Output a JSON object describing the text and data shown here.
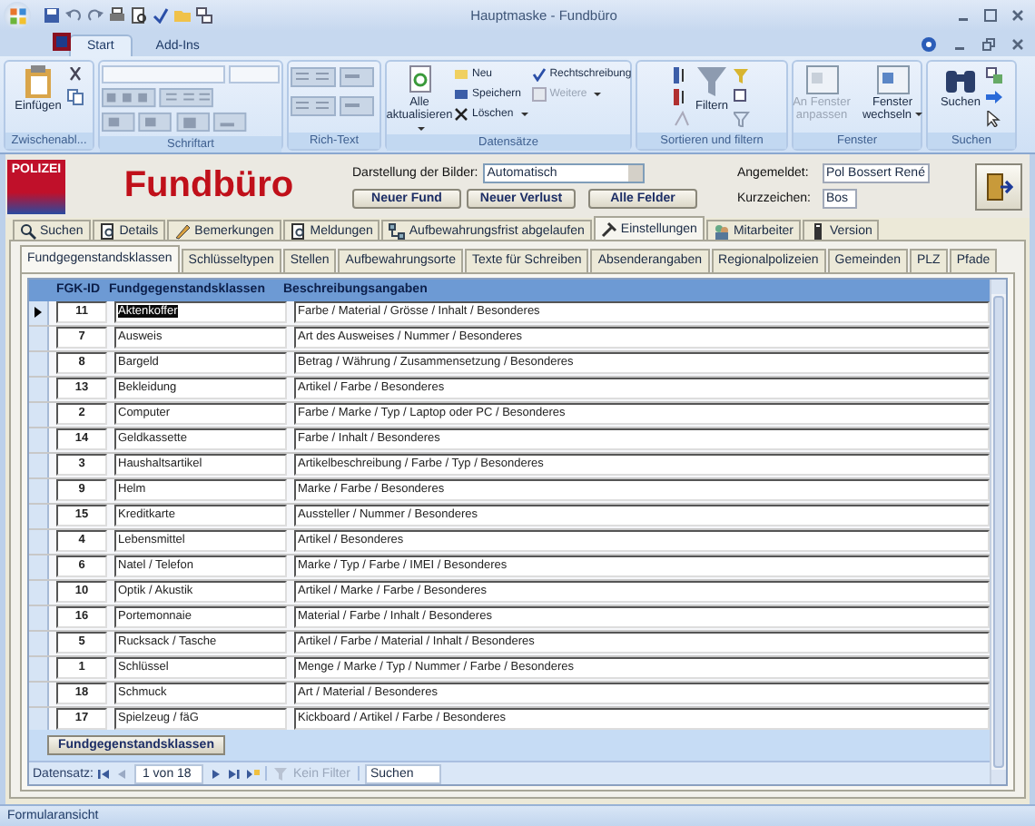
{
  "window": {
    "title": "Hauptmaske - Fundbüro"
  },
  "ribbon": {
    "tabs": [
      {
        "label": "Start",
        "selected": true
      },
      {
        "label": "Add-Ins",
        "selected": false
      }
    ],
    "groups": [
      {
        "kind": "clipboard",
        "label": "Zwischenabl...",
        "buttons": [
          {
            "label": "Einfügen",
            "disabled": false
          }
        ]
      },
      {
        "kind": "font",
        "label": "Schriftart"
      },
      {
        "kind": "richtext",
        "label": "Rich-Text"
      },
      {
        "kind": "records",
        "label": "Datensätze",
        "buttons": [
          {
            "label": "Alle aktualisieren",
            "disabled": false
          },
          {
            "label": "Neu",
            "disabled": false
          },
          {
            "label": "Speichern",
            "disabled": false
          },
          {
            "label": "Löschen",
            "disabled": false
          },
          {
            "label": "Rechtschreibung",
            "disabled": false
          },
          {
            "label": "Weitere",
            "disabled": true
          }
        ]
      },
      {
        "kind": "sort",
        "label": "Sortieren und filtern",
        "buttons": [
          {
            "label": "Filtern",
            "disabled": false
          }
        ]
      },
      {
        "kind": "window",
        "label": "Fenster",
        "buttons": [
          {
            "label": "An Fenster anpassen",
            "disabled": true
          },
          {
            "label": "Fenster wechseln",
            "disabled": false
          }
        ]
      },
      {
        "kind": "find",
        "label": "Suchen",
        "buttons": [
          {
            "label": "Suchen",
            "disabled": false
          }
        ]
      }
    ]
  },
  "header": {
    "logo": "POLIZEI",
    "title": "Fundbüro",
    "image_display": {
      "label": "Darstellung der Bilder:",
      "value": "Automatisch"
    },
    "buttons": [
      "Neuer Fund",
      "Neuer Verlust",
      "Alle Felder"
    ],
    "logged_in": {
      "label": "Angemeldet:",
      "value": "Pol Bossert René"
    },
    "initials": {
      "label": "Kurzzeichen:",
      "value": "Bos"
    }
  },
  "tabs": [
    {
      "label": "Suchen",
      "selected": false
    },
    {
      "label": "Details",
      "selected": false
    },
    {
      "label": "Bemerkungen",
      "selected": false
    },
    {
      "label": "Meldungen",
      "selected": false
    },
    {
      "label": "Aufbewahrungsfrist abgelaufen",
      "selected": false
    },
    {
      "label": "Einstellungen",
      "selected": true
    },
    {
      "label": "Mitarbeiter",
      "selected": false
    },
    {
      "label": "Version",
      "selected": false
    }
  ],
  "subtabs": [
    {
      "label": "Fundgegenstandsklassen",
      "selected": true
    },
    {
      "label": "Schlüsseltypen",
      "selected": false
    },
    {
      "label": "Stellen",
      "selected": false
    },
    {
      "label": "Aufbewahrungsorte",
      "selected": false
    },
    {
      "label": "Texte für Schreiben",
      "selected": false
    },
    {
      "label": "Absenderangaben",
      "selected": false
    },
    {
      "label": "Regionalpolizeien",
      "selected": false
    },
    {
      "label": "Gemeinden",
      "selected": false
    },
    {
      "label": "PLZ",
      "selected": false
    },
    {
      "label": "Pfade",
      "selected": false
    }
  ],
  "table": {
    "columns": [
      "FGK-ID",
      "Fundgegenstandsklassen",
      "Beschreibungsangaben"
    ],
    "rows": [
      {
        "id": "11",
        "name": "Aktenkoffer",
        "description": "Farbe / Material / Grösse / Inhalt / Besonderes",
        "selected": true
      },
      {
        "id": "7",
        "name": "Ausweis",
        "description": "Art des Ausweises / Nummer / Besonderes",
        "selected": false
      },
      {
        "id": "8",
        "name": "Bargeld",
        "description": "Betrag / Währung / Zusammensetzung / Besonderes",
        "selected": false
      },
      {
        "id": "13",
        "name": "Bekleidung",
        "description": "Artikel / Farbe / Besonderes",
        "selected": false
      },
      {
        "id": "2",
        "name": "Computer",
        "description": "Farbe / Marke / Typ / Laptop oder PC / Besonderes",
        "selected": false
      },
      {
        "id": "14",
        "name": "Geldkassette",
        "description": "Farbe / Inhalt / Besonderes",
        "selected": false
      },
      {
        "id": "3",
        "name": "Haushaltsartikel",
        "description": "Artikelbeschreibung / Farbe / Typ / Besonderes",
        "selected": false
      },
      {
        "id": "9",
        "name": "Helm",
        "description": "Marke / Farbe / Besonderes",
        "selected": false
      },
      {
        "id": "15",
        "name": "Kreditkarte",
        "description": "Aussteller / Nummer / Besonderes",
        "selected": false
      },
      {
        "id": "4",
        "name": "Lebensmittel",
        "description": "Artikel / Besonderes",
        "selected": false
      },
      {
        "id": "6",
        "name": "Natel / Telefon",
        "description": "Marke / Typ / Farbe / IMEI / Besonderes",
        "selected": false
      },
      {
        "id": "10",
        "name": "Optik / Akustik",
        "description": "Artikel / Marke / Farbe / Besonderes",
        "selected": false
      },
      {
        "id": "16",
        "name": "Portemonnaie",
        "description": "Material / Farbe / Inhalt / Besonderes",
        "selected": false
      },
      {
        "id": "5",
        "name": "Rucksack / Tasche",
        "description": "Artikel / Farbe / Material / Inhalt / Besonderes",
        "selected": false
      },
      {
        "id": "1",
        "name": "Schlüssel",
        "description": "Menge / Marke / Typ / Nummer / Farbe / Besonderes",
        "selected": false
      },
      {
        "id": "18",
        "name": "Schmuck",
        "description": "Art / Material / Besonderes",
        "selected": false
      },
      {
        "id": "17",
        "name": "Spielzeug / fäG",
        "description": "Kickboard / Artikel / Farbe / Besonderes",
        "selected": false
      }
    ]
  },
  "footer_button": "Fundgegenstandsklassen",
  "navigation": {
    "label": "Datensatz:",
    "position": "1 von 18",
    "filter": {
      "label": "Kein Filter",
      "disabled": true
    },
    "search": {
      "placeholder": "Suchen"
    }
  },
  "status_bar": "Formularansicht"
}
